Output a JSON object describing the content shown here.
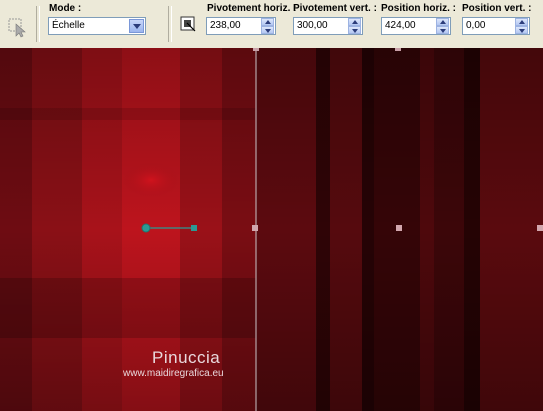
{
  "toolbar": {
    "mode": {
      "label": "Mode :",
      "value": "Échelle"
    },
    "pivot_h": {
      "label": "Pivotement horiz. :",
      "value": "238,00"
    },
    "pivot_v": {
      "label": "Pivotement vert. :",
      "value": "300,00"
    },
    "pos_h": {
      "label": "Position horiz. :",
      "value": "424,00"
    },
    "pos_v": {
      "label": "Position vert. :",
      "value": "0,00"
    }
  },
  "canvas": {
    "watermark_name": "Pinuccia",
    "watermark_url": "www.maidiregrafica.eu",
    "colors": {
      "dark": "#3a0508",
      "mid": "#8b1218",
      "bright": "#d8141e",
      "handle": "#2a9a94"
    }
  }
}
